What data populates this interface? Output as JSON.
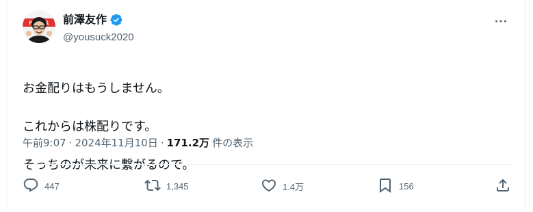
{
  "author": {
    "display_name": "前澤友作",
    "handle": "@yousuck2020",
    "verified": true,
    "avatar_badge_text": "KABU&"
  },
  "tweet": {
    "text_lines": [
      "お金配りはもうしません。",
      "これからは株配りです。",
      "そっちのが未来に繋がるので。"
    ]
  },
  "meta": {
    "time": "午前9:07",
    "separator": "·",
    "date": "2024年11月10日",
    "views_count": "171.2万",
    "views_label": "件の表示"
  },
  "actions": {
    "reply": {
      "icon": "reply-icon",
      "count": "447"
    },
    "retweet": {
      "icon": "retweet-icon",
      "count": "1,345"
    },
    "like": {
      "icon": "heart-icon",
      "count": "1.4万"
    },
    "bookmark": {
      "icon": "bookmark-icon",
      "count": "156"
    },
    "share": {
      "icon": "share-icon"
    }
  },
  "colors": {
    "text": "#0f1419",
    "secondary": "#536471",
    "verified_blue": "#1d9bf0",
    "divider": "#eff3f4",
    "badge_red": "#e0322d"
  }
}
